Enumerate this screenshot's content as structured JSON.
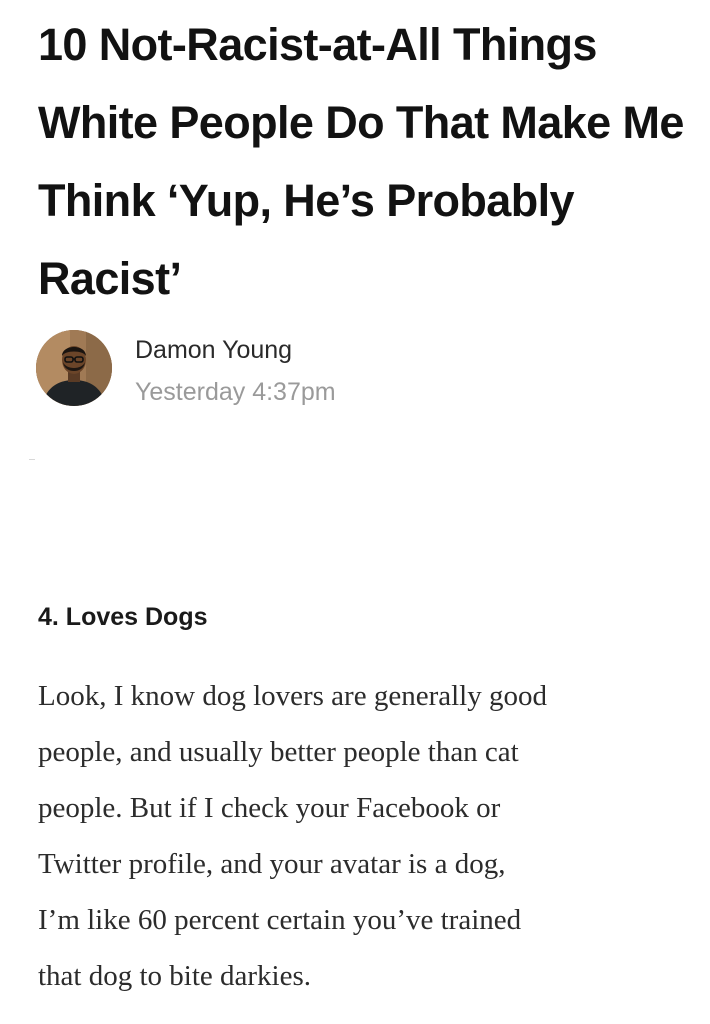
{
  "article": {
    "headline": "10 Not-Racist-at-All Things White People Do That Make Me Think ‘Yup, He’s Probably Racist’",
    "author": {
      "name": "Damon Young",
      "timestamp": "Yesterday 4:37pm",
      "avatar_icon": "author-avatar-photo"
    },
    "section": {
      "heading": "4. Loves Dogs",
      "body": "Look, I know dog lovers are generally good\npeople, and usually better people than cat\npeople. But if I check your Facebook or\nTwitter profile, and your avatar is a dog,\nI’m like 60 percent certain you’ve trained\nthat dog to bite darkies."
    }
  },
  "colors": {
    "text": "#121212",
    "meta": "#9a9a9a",
    "background": "#ffffff"
  }
}
